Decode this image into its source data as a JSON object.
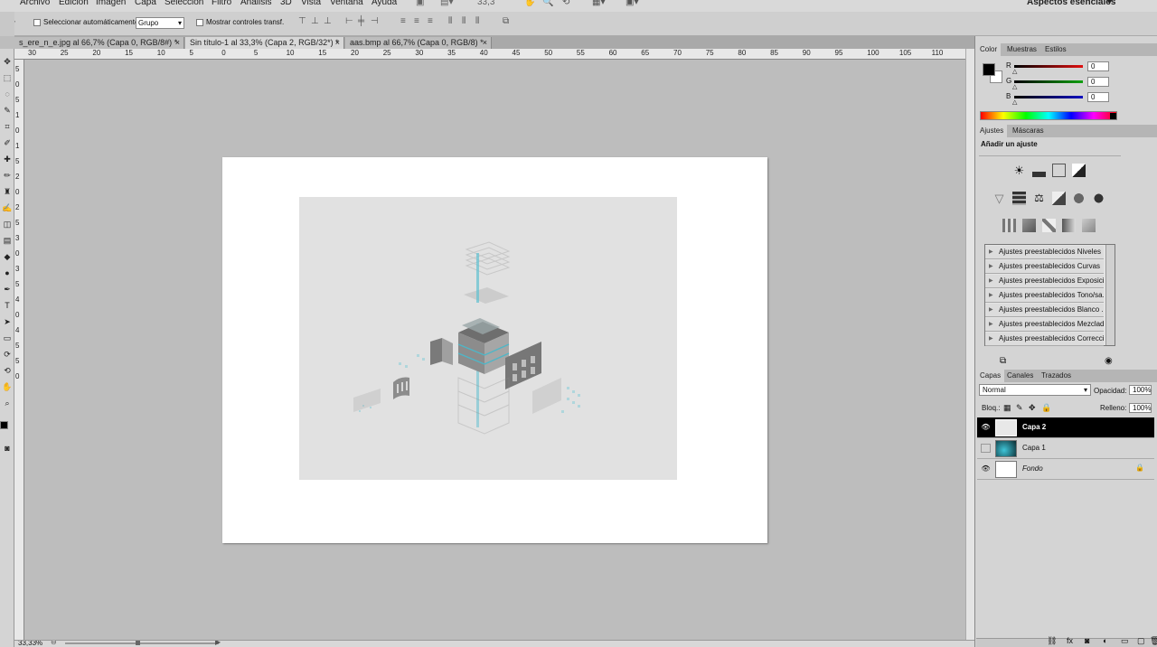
{
  "menubar": {
    "items": [
      "Archivo",
      "Edición",
      "Imagen",
      "Capa",
      "Selección",
      "Filtro",
      "Análisis",
      "3D",
      "Vista",
      "Ventana",
      "Ayuda"
    ],
    "zoom": "33,3",
    "workspace": "Aspectos esenciales"
  },
  "options": {
    "auto_select_label": "Seleccionar automáticamente:",
    "auto_select_value": "Grupo",
    "show_transform_label": "Mostrar controles transf."
  },
  "tabs": [
    {
      "label": "s_ere_n_e.jpg al 66,7% (Capa 0, RGB/8#) *",
      "active": false
    },
    {
      "label": "Sin título-1 al 33,3% (Capa 2, RGB/32*) *",
      "active": true
    },
    {
      "label": "aas.bmp al 66,7% (Capa 0, RGB/8) *",
      "active": false
    }
  ],
  "tab_close": "×",
  "ruler": {
    "top": [
      "30",
      "25",
      "20",
      "15",
      "10",
      "5",
      "0",
      "5",
      "10",
      "15",
      "20",
      "25",
      "30",
      "35",
      "40",
      "45",
      "50",
      "55",
      "60",
      "65",
      "70",
      "75",
      "80",
      "85",
      "90",
      "95",
      "100",
      "105",
      "110"
    ],
    "left": [
      "5",
      "0",
      "5",
      "1",
      "0",
      "1",
      "5",
      "2",
      "0",
      "2",
      "5",
      "3",
      "0",
      "3",
      "5",
      "4",
      "0",
      "4",
      "5",
      "5",
      "0"
    ]
  },
  "status": {
    "zoom": "33,33%"
  },
  "color_panel": {
    "tabs": [
      "Color",
      "Muestras",
      "Estilos"
    ],
    "channels": [
      {
        "label": "R",
        "value": "0",
        "color": "#e01010"
      },
      {
        "label": "G",
        "value": "0",
        "color": "#10a010"
      },
      {
        "label": "B",
        "value": "0",
        "color": "#1010c0"
      }
    ]
  },
  "adjust_panel": {
    "tabs": [
      "Ajustes",
      "Máscaras"
    ],
    "title": "Añadir un ajuste",
    "presets": [
      "Ajustes preestablecidos Niveles",
      "Ajustes preestablecidos Curvas",
      "Ajustes preestablecidos Exposici...",
      "Ajustes preestablecidos Tono/sa...",
      "Ajustes preestablecidos Blanco ...",
      "Ajustes preestablecidos Mezclad...",
      "Ajustes preestablecidos Correcci..."
    ]
  },
  "layers_panel": {
    "tabs": [
      "Capas",
      "Canales",
      "Trazados"
    ],
    "blend_mode": "Normal",
    "opacity_label": "Opacidad:",
    "opacity_value": "100%",
    "lock_label": "Bloq.:",
    "fill_label": "Relleno:",
    "fill_value": "100%",
    "layers": [
      {
        "name": "Capa 2",
        "selected": true,
        "visible": true
      },
      {
        "name": "Capa 1",
        "selected": false,
        "visible": false
      },
      {
        "name": "Fondo",
        "selected": false,
        "visible": true,
        "locked": true
      }
    ]
  },
  "colors": {
    "accent": "#4fb6c7",
    "selection": "#000000"
  }
}
